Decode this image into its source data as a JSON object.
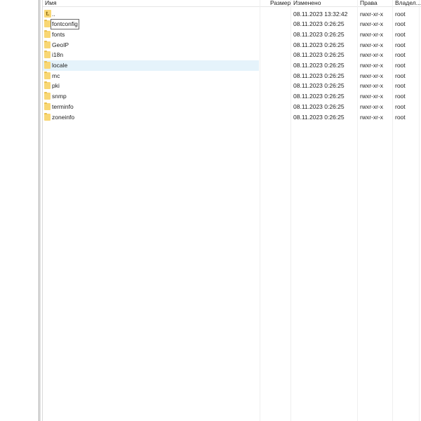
{
  "columns": {
    "name": "Имя",
    "size": "Размер",
    "modified": "Изменено",
    "rights": "Права",
    "owner": "Владел..."
  },
  "rows": [
    {
      "name": "..",
      "icon": "up-folder-icon",
      "size": "",
      "modified": "08.11.2023 13:32:42",
      "rights": "rwxr-xr-x",
      "owner": "root"
    },
    {
      "name": "fontconfig",
      "icon": "folder-icon",
      "size": "",
      "modified": "08.11.2023 0:26:25",
      "rights": "rwxr-xr-x",
      "owner": "root"
    },
    {
      "name": "fonts",
      "icon": "folder-icon",
      "size": "",
      "modified": "08.11.2023 0:26:25",
      "rights": "rwxr-xr-x",
      "owner": "root"
    },
    {
      "name": "GeoIP",
      "icon": "folder-icon",
      "size": "",
      "modified": "08.11.2023 0:26:25",
      "rights": "rwxr-xr-x",
      "owner": "root"
    },
    {
      "name": "i18n",
      "icon": "folder-icon",
      "size": "",
      "modified": "08.11.2023 0:26:25",
      "rights": "rwxr-xr-x",
      "owner": "root"
    },
    {
      "name": "locale",
      "icon": "folder-icon",
      "size": "",
      "modified": "08.11.2023 0:26:25",
      "rights": "rwxr-xr-x",
      "owner": "root"
    },
    {
      "name": "mc",
      "icon": "folder-icon",
      "size": "",
      "modified": "08.11.2023 0:26:25",
      "rights": "rwxr-xr-x",
      "owner": "root"
    },
    {
      "name": "pki",
      "icon": "folder-icon",
      "size": "",
      "modified": "08.11.2023 0:26:25",
      "rights": "rwxr-xr-x",
      "owner": "root"
    },
    {
      "name": "snmp",
      "icon": "folder-icon",
      "size": "",
      "modified": "08.11.2023 0:26:25",
      "rights": "rwxr-xr-x",
      "owner": "root"
    },
    {
      "name": "terminfo",
      "icon": "folder-icon",
      "size": "",
      "modified": "08.11.2023 0:26:25",
      "rights": "rwxr-xr-x",
      "owner": "root"
    },
    {
      "name": "zoneinfo",
      "icon": "folder-icon",
      "size": "",
      "modified": "08.11.2023 0:26:25",
      "rights": "rwxr-xr-x",
      "owner": "root"
    }
  ],
  "selected_row": "locale",
  "focused_row": "fontconfig",
  "colors": {
    "selection": "#e5f3fb",
    "folder": "#f8d775"
  }
}
